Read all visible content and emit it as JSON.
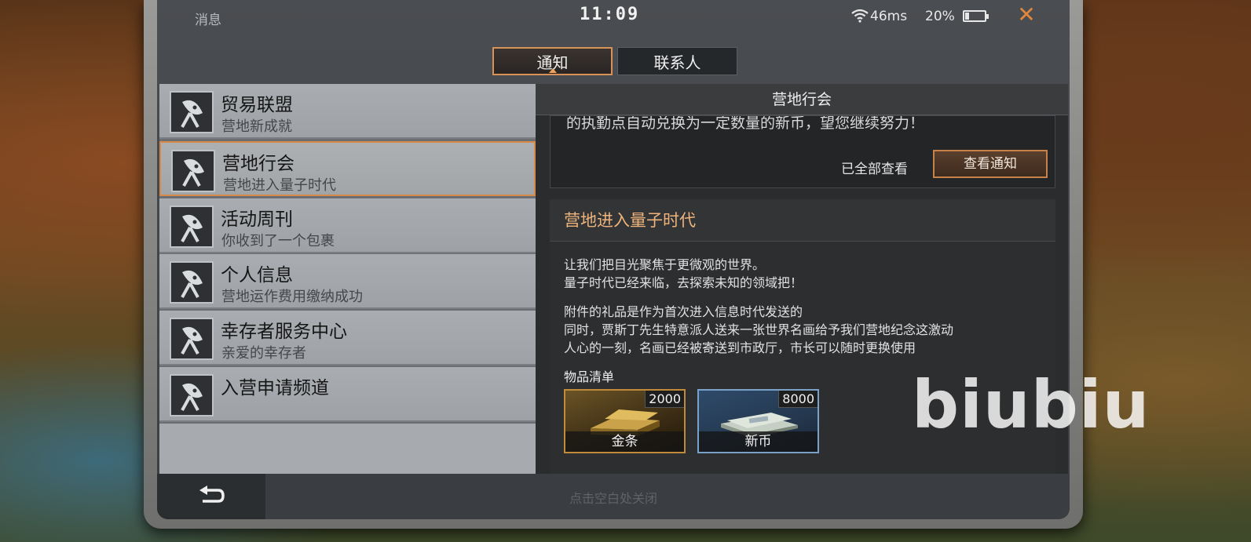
{
  "status_bar": {
    "left_label": "消息",
    "time": "11:09",
    "ping": "46ms",
    "battery_percent": "20%",
    "battery_level": 0.2,
    "close_icon": "close-x-icon"
  },
  "tabs": [
    {
      "label": "通知",
      "active": true
    },
    {
      "label": "联系人",
      "active": false
    }
  ],
  "channels": [
    {
      "title": "贸易联盟",
      "subtitle": "营地新成就",
      "icon": "satellite-dish-icon"
    },
    {
      "title": "营地行会",
      "subtitle": "营地进入量子时代",
      "icon": "satellite-dish-icon",
      "selected": true
    },
    {
      "title": "活动周刊",
      "subtitle": "你收到了一个包裹",
      "icon": "satellite-dish-icon"
    },
    {
      "title": "个人信息",
      "subtitle": "营地运作费用缴纳成功",
      "icon": "satellite-dish-icon"
    },
    {
      "title": "幸存者服务中心",
      "subtitle": "亲爱的幸存者",
      "icon": "satellite-dish-icon"
    },
    {
      "title": "入营申请频道",
      "subtitle": "",
      "icon": "satellite-dish-icon"
    }
  ],
  "panel": {
    "header": "营地行会",
    "previous_text": "的执勤点自动兑换为一定数量的新币，望您继续努力！",
    "all_read_label": "已全部查看",
    "view_button": "查看通知"
  },
  "message": {
    "title": "营地进入量子时代",
    "para1_line1": "让我们把目光聚焦于更微观的世界。",
    "para1_line2": "量子时代已经来临，去探索未知的领域把！",
    "para2_line1": "附件的礼品是作为首次进入信息时代发送的",
    "para2_line2": "同时，贾斯丁先生特意派人送来一张世界名画给予我们营地纪念这激动",
    "para2_line3": "人心的一刻，名画已经被寄送到市政厅，市长可以随时更换使用",
    "items_label": "物品清单",
    "items": [
      {
        "name": "金条",
        "qty": "2000"
      },
      {
        "name": "新币",
        "qty": "8000"
      }
    ]
  },
  "bottom": {
    "hint": "点击空白处关闭",
    "back_icon": "back-arrow-icon"
  },
  "watermark": "biubiu"
}
